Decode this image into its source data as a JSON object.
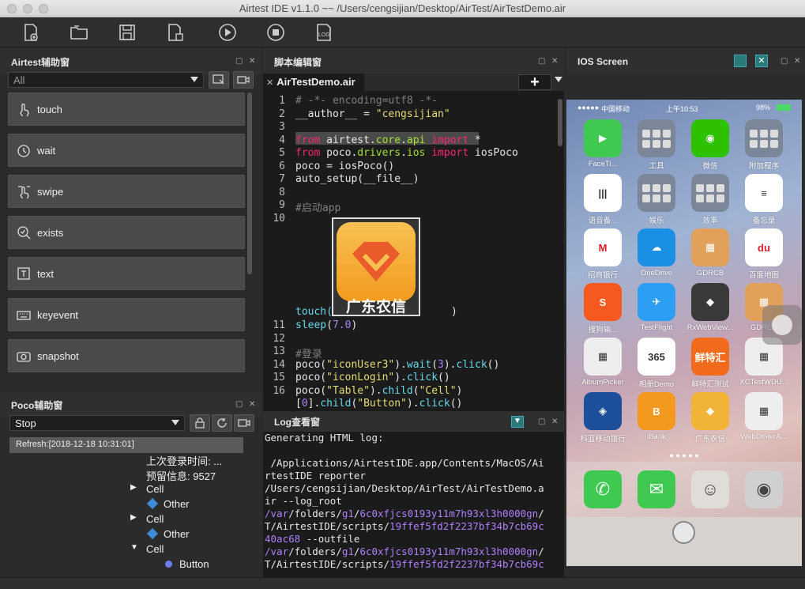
{
  "window": {
    "title": "Airtest IDE v1.1.0 ~~ /Users/cengsijian/Desktop/AirTest/AirTestDemo.air"
  },
  "toolbar": {
    "log_label": "LOG"
  },
  "helper_panel": {
    "title": "Airtest辅助窗",
    "filter_value": "All",
    "items": [
      {
        "label": "touch",
        "icon": "touch-icon"
      },
      {
        "label": "wait",
        "icon": "clock-icon"
      },
      {
        "label": "swipe",
        "icon": "swipe-icon"
      },
      {
        "label": "exists",
        "icon": "magnifier-check-icon"
      },
      {
        "label": "text",
        "icon": "text-box-icon"
      },
      {
        "label": "keyevent",
        "icon": "keyboard-icon"
      },
      {
        "label": "snapshot",
        "icon": "camera-icon"
      }
    ]
  },
  "editor_panel": {
    "title": "脚本编辑窗",
    "tab": "AirTestDemo.air",
    "plus": "+",
    "lines": [
      {
        "n": "1",
        "html": [
          [
            "cm",
            "# -*- encoding=utf8 -*-"
          ]
        ]
      },
      {
        "n": "2",
        "html": [
          [
            "",
            "__author__ = "
          ],
          [
            "str",
            "\"cengsijian\""
          ]
        ]
      },
      {
        "n": "3",
        "html": []
      },
      {
        "n": "4",
        "html": [
          [
            "kw",
            "from"
          ],
          [
            "",
            " airtest."
          ],
          [
            "mod",
            "core"
          ],
          [
            "",
            "."
          ],
          [
            "mod",
            "api"
          ],
          [
            "",
            " "
          ],
          [
            "kw",
            "import"
          ],
          [
            "",
            " *"
          ]
        ]
      },
      {
        "n": "5",
        "html": [
          [
            "kw",
            "from"
          ],
          [
            "",
            " poco."
          ],
          [
            "mod",
            "drivers"
          ],
          [
            "",
            "."
          ],
          [
            "mod",
            "ios"
          ],
          [
            "",
            " "
          ],
          [
            "kw",
            "import"
          ],
          [
            "",
            " iosPoco"
          ]
        ]
      },
      {
        "n": "6",
        "html": [
          [
            "",
            "poco = iosPoco()"
          ]
        ]
      },
      {
        "n": "7",
        "html": [
          [
            "",
            "auto_setup(__file__)"
          ]
        ]
      },
      {
        "n": "8",
        "html": []
      },
      {
        "n": "9",
        "html": [
          [
            "cm",
            "#启动app"
          ]
        ]
      },
      {
        "n": "10",
        "html": []
      }
    ],
    "touch_prefix": "touch(",
    "touch_suffix": ")",
    "image_caption": "广东农信",
    "lines2": [
      {
        "n": "11",
        "html": [
          [
            "fn",
            "sleep"
          ],
          [
            "",
            "("
          ],
          [
            "num",
            "7.0"
          ],
          [
            "",
            ")"
          ]
        ]
      },
      {
        "n": "12",
        "html": []
      },
      {
        "n": "13",
        "html": [
          [
            "cm",
            "#登录"
          ]
        ]
      },
      {
        "n": "14",
        "html": [
          [
            "",
            "poco("
          ],
          [
            "str",
            "\"iconUser3\""
          ],
          [
            "",
            ")."
          ],
          [
            "fn",
            "wait"
          ],
          [
            "",
            "("
          ],
          [
            "num",
            "3"
          ],
          [
            "",
            ")."
          ],
          [
            "fn",
            "click"
          ],
          [
            "",
            "()"
          ]
        ]
      },
      {
        "n": "15",
        "html": [
          [
            "",
            "poco("
          ],
          [
            "str",
            "\"iconLogin\""
          ],
          [
            "",
            ")."
          ],
          [
            "fn",
            "click"
          ],
          [
            "",
            "()"
          ]
        ]
      },
      {
        "n": "16",
        "html": [
          [
            "",
            "poco("
          ],
          [
            "str",
            "\"Table\""
          ],
          [
            "",
            ")."
          ],
          [
            "fn",
            "child"
          ],
          [
            "",
            "("
          ],
          [
            "str",
            "\"Cell\""
          ],
          [
            "",
            ")"
          ]
        ]
      },
      {
        "n": "",
        "html": [
          [
            "",
            "["
          ],
          [
            "num",
            "0"
          ],
          [
            "",
            "]."
          ],
          [
            "fn",
            "child"
          ],
          [
            "",
            "("
          ],
          [
            "str",
            "\"Button\""
          ],
          [
            "",
            ")."
          ],
          [
            "fn",
            "click"
          ],
          [
            "",
            "()"
          ]
        ]
      }
    ]
  },
  "log_panel": {
    "title": "Log查看窗",
    "lines": [
      [
        [
          "",
          "Generating HTML log:"
        ]
      ],
      [
        [
          "",
          ""
        ]
      ],
      [
        [
          "",
          " /Applications/AirtestIDE.app/Contents/MacOS/Ai"
        ]
      ],
      [
        [
          "",
          "rtestIDE reporter"
        ]
      ],
      [
        [
          "",
          "/Users/cengsijian/Desktop/AirTest/AirTestDemo.a"
        ]
      ],
      [
        [
          "",
          "ir --log_root"
        ]
      ],
      [
        [
          "num",
          "/var"
        ],
        [
          "",
          "/folders/"
        ],
        [
          "num",
          "g1"
        ],
        [
          "",
          "/"
        ],
        [
          "num",
          "6c0xfjcs0193y11m7h93xl3h0000gn"
        ],
        [
          "",
          "/"
        ]
      ],
      [
        [
          "",
          "T/AirtestIDE/scripts/"
        ],
        [
          "num",
          "19ffef5fd2f2237bf34b7cb69c"
        ]
      ],
      [
        [
          "num",
          "40ac68"
        ],
        [
          "",
          " --outfile"
        ]
      ],
      [
        [
          "num",
          "/var"
        ],
        [
          "",
          "/folders/"
        ],
        [
          "num",
          "g1"
        ],
        [
          "",
          "/"
        ],
        [
          "num",
          "6c0xfjcs0193y11m7h93xl3h0000gn"
        ],
        [
          "",
          "/"
        ]
      ],
      [
        [
          "",
          "T/AirtestIDE/scripts/"
        ],
        [
          "num",
          "19ffef5fd2f2237bf34b7cb69c"
        ]
      ]
    ]
  },
  "poco_panel": {
    "title": "Poco辅助窗",
    "mode_value": "Stop",
    "refresh_text": "Refresh:[2018-12-18 10:31:01]",
    "tree": [
      {
        "label": "上次登录时间: ...",
        "indent": 185,
        "bullet": ""
      },
      {
        "label": "预留信息: 9527",
        "indent": 185,
        "bullet": ""
      },
      {
        "label": "Cell",
        "indent": 185,
        "bullet": "arrow-right"
      },
      {
        "label": "Other",
        "indent": 207,
        "bullet": "layer"
      },
      {
        "label": "Cell",
        "indent": 185,
        "bullet": "arrow-right"
      },
      {
        "label": "Other",
        "indent": 207,
        "bullet": "layer"
      },
      {
        "label": "Cell",
        "indent": 185,
        "bullet": "arrow-down"
      },
      {
        "label": "Button",
        "indent": 227,
        "bullet": "dot"
      }
    ]
  },
  "ios_panel": {
    "title": "IOS Screen",
    "status": {
      "carrier": "中国移动",
      "time": "上午10:53",
      "battery": "98%"
    },
    "apps": [
      {
        "label": "FaceTi...",
        "bg": "#3fc950",
        "glyph": "▶",
        "cloud": true
      },
      {
        "label": "工具",
        "bg": "#7b8798",
        "glyph": "",
        "folder": true
      },
      {
        "label": "微信",
        "bg": "#2dc100",
        "glyph": "◉"
      },
      {
        "label": "附加程序",
        "bg": "#7b8798",
        "glyph": "",
        "folder": true
      },
      {
        "label": "语音备...",
        "bg": "#ffffff",
        "glyph": "|||",
        "cloud": true,
        "dark": true
      },
      {
        "label": "娱乐",
        "bg": "#7b8798",
        "glyph": "",
        "folder": true
      },
      {
        "label": "效率",
        "bg": "#7b8798",
        "glyph": "",
        "folder": true
      },
      {
        "label": "备忘录",
        "bg": "#ffffff",
        "glyph": "≡",
        "cloud": true,
        "dark": true
      },
      {
        "label": "招商银行",
        "bg": "#ffffff",
        "glyph": "M",
        "cloud": true,
        "red": true
      },
      {
        "label": "OneDrive",
        "bg": "#1a8fe3",
        "glyph": "☁",
        "cloud": true
      },
      {
        "label": "GDRCB",
        "bg": "#e2a15a",
        "glyph": "▦"
      },
      {
        "label": "百度地图",
        "bg": "#ffffff",
        "glyph": "du",
        "red": true
      },
      {
        "label": "搜狗输...",
        "bg": "#f5591f",
        "glyph": "S",
        "cloud": true
      },
      {
        "label": "TestFlight",
        "bg": "#2c9ef4",
        "glyph": "✈"
      },
      {
        "label": "RxWebView...",
        "bg": "#3a3a3a",
        "glyph": "◆"
      },
      {
        "label": "GDRCB",
        "bg": "#e2a15a",
        "glyph": "▦"
      },
      {
        "label": "AlbumPicker",
        "bg": "#eeeeee",
        "glyph": "▦",
        "dark": true
      },
      {
        "label": "相册Demo",
        "bg": "#ffffff",
        "glyph": "365",
        "dark": true
      },
      {
        "label": "鲜特汇测试",
        "bg": "#f26a1b",
        "glyph": "鲜特汇"
      },
      {
        "label": "XCTestWDU...",
        "bg": "#eeeeee",
        "glyph": "▦",
        "dark": true
      },
      {
        "label": "科蓝移动银行",
        "bg": "#1e4f9a",
        "glyph": "◈"
      },
      {
        "label": "iBank",
        "bg": "#f39a1e",
        "glyph": "B"
      },
      {
        "label": "广东农信",
        "bg": "#f2b437",
        "glyph": "◆"
      },
      {
        "label": "WebDriverA...",
        "bg": "#eeeeee",
        "glyph": "▦",
        "dark": true
      }
    ],
    "dock": [
      {
        "label": "phone",
        "bg": "#3fc950",
        "glyph": "✆"
      },
      {
        "label": "messages",
        "bg": "#3fc950",
        "glyph": "✉"
      },
      {
        "label": "contacts",
        "bg": "#e0ddd8",
        "glyph": "☺"
      },
      {
        "label": "camera",
        "bg": "#d0d0d0",
        "glyph": "◉"
      }
    ]
  }
}
